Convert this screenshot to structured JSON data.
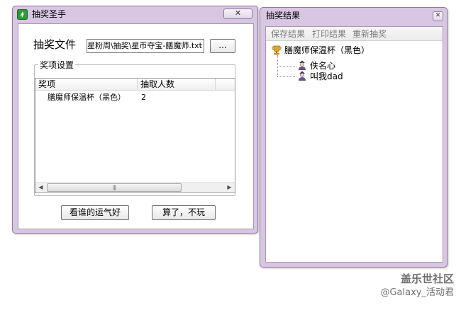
{
  "main_window": {
    "title": "抽奖圣手",
    "close_glyph": "✕",
    "file_label": "抽奖文件",
    "file_path": "D:\\星粉周\\抽奖\\星币夺宝-膳魔师.txt",
    "browse_label": "...",
    "group_title": "奖项设置",
    "table": {
      "columns": [
        "奖项",
        "抽取人数"
      ],
      "rows": [
        {
          "prize": "膳魔师保温杯（黑色）",
          "count": "2"
        }
      ]
    },
    "scroll_left_glyph": "◀",
    "scroll_right_glyph": "▶",
    "scroll_grip": "|||",
    "draw_button": "看谁的运气好",
    "quit_button": "算了，不玩"
  },
  "result_window": {
    "title": "抽奖结果",
    "close_glyph": "✕",
    "toolbar": [
      "保存结果",
      "打印结果",
      "重新抽奖"
    ],
    "tree": {
      "prize": "膳魔师保温杯（黑色）",
      "winners": [
        "佚名心",
        "叫我dad"
      ]
    }
  },
  "watermark": {
    "line1": "盖乐世社区",
    "line2": "@Galaxy_活动君"
  },
  "colors": {
    "window_frame": "#d9c6e3",
    "app_icon": "#2e9a3a",
    "trophy": "#e0a81c",
    "user_icon": "#6a4f8f"
  }
}
